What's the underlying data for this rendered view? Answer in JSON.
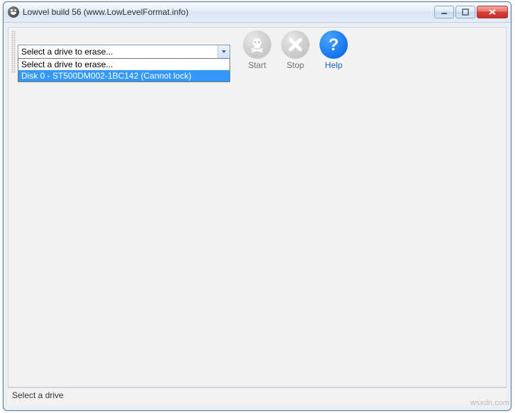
{
  "titlebar": {
    "text": "Lowvel build 56 (www.LowLevelFormat.info)"
  },
  "dropdown": {
    "placeholder": "Select a drive to erase...",
    "items": [
      {
        "label": "Select a drive to erase...",
        "selected": false
      },
      {
        "label": "Disk 0 - ST500DM002-1BC142 (Cannot lock)",
        "selected": true
      }
    ]
  },
  "actions": {
    "start": {
      "label": "Start",
      "enabled": false
    },
    "stop": {
      "label": "Stop",
      "enabled": false
    },
    "help": {
      "label": "Help",
      "enabled": true
    }
  },
  "statusbar": {
    "text": "Select a drive"
  },
  "watermark": "wsxdn.com"
}
